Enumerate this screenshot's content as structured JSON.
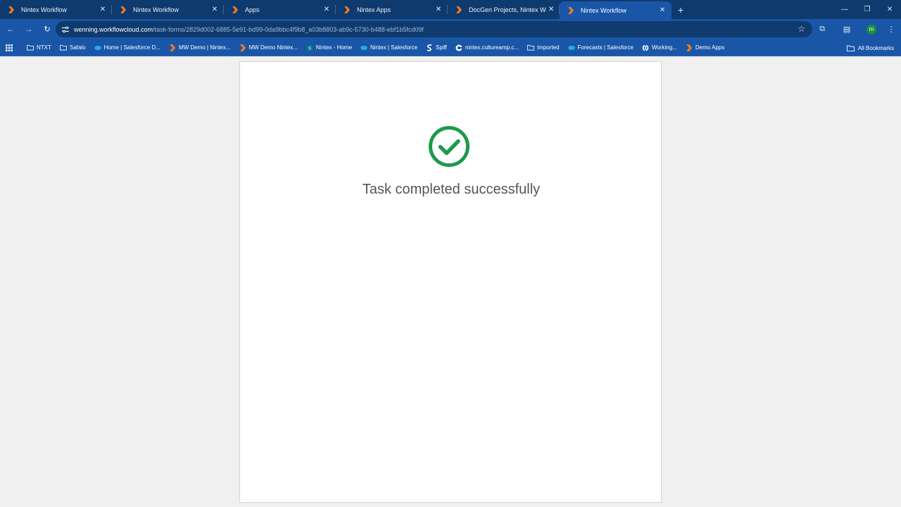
{
  "tabs": [
    {
      "title": "Nintex Workflow",
      "active": false
    },
    {
      "title": "Nintex Workflow",
      "active": false
    },
    {
      "title": "Apps",
      "active": false
    },
    {
      "title": "Nintex Apps",
      "active": false
    },
    {
      "title": "DocGen Projects, Nintex Workfl",
      "active": false
    },
    {
      "title": "Nintex Workflow",
      "active": true
    }
  ],
  "address": {
    "host": "wenning.workflowcloud.com",
    "path": "/task-forms/2829d002-6885-5e91-bd99-0da9bbc4f9b8_a03b8803-ab9c-5730-b488-ebf1b5fcd09f"
  },
  "profile": {
    "initial": "m"
  },
  "bookmarks": [
    {
      "label": "NTXT",
      "icon": "folder-icon"
    },
    {
      "label": "Safalo",
      "icon": "folder-icon"
    },
    {
      "label": "Home | Salesforce D...",
      "icon": "salesforce-icon"
    },
    {
      "label": "MW Demo | Nintex...",
      "icon": "nintex-icon"
    },
    {
      "label": "MW Demo Nintex...",
      "icon": "nintex-icon"
    },
    {
      "label": "Nintex - Home",
      "icon": "sharepoint-icon"
    },
    {
      "label": "Nintex | Salesforce",
      "icon": "salesforce-icon"
    },
    {
      "label": "Spiff",
      "icon": "spiff-icon"
    },
    {
      "label": "nintex.cultureamp.c...",
      "icon": "cultureamp-icon"
    },
    {
      "label": "Imported",
      "icon": "folder-icon"
    },
    {
      "label": "Forecasts | Salesforce",
      "icon": "salesforce-icon"
    },
    {
      "label": "Working...",
      "icon": "globe-icon"
    },
    {
      "label": "Demo Apps",
      "icon": "nintex-icon"
    }
  ],
  "all_bookmarks": "All Bookmarks",
  "page": {
    "message": "Task completed successfully"
  },
  "colors": {
    "tabstrip": "#0f3a6e",
    "toolbar": "#1a56a8",
    "nintex_orange": "#f47b20",
    "success_green": "#1e9a4b"
  }
}
